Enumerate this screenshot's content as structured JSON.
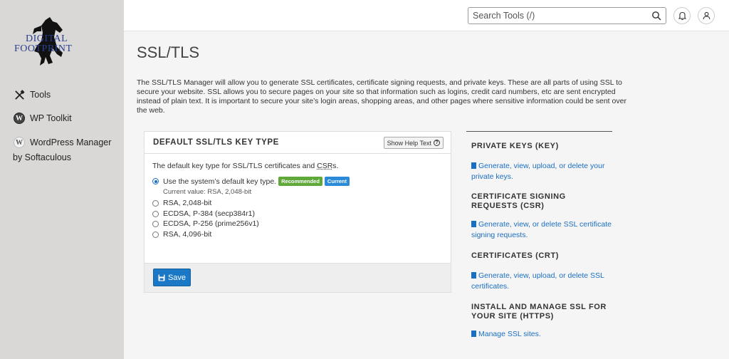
{
  "sidebar": {
    "logo": {
      "line1": "DIGITAL",
      "line2": "FOOTPRINT"
    },
    "items": [
      {
        "label": "Tools",
        "icon": "tools-icon"
      },
      {
        "label": "WP Toolkit",
        "icon": "wordpress-icon"
      },
      {
        "label": "WordPress Manager",
        "icon": "wordpress-icon"
      }
    ],
    "item3_sub": "by Softaculous"
  },
  "header": {
    "search_placeholder": "Search Tools (/)",
    "icons": [
      "search-icon",
      "bell-icon",
      "user-icon"
    ]
  },
  "main": {
    "title": "SSL/TLS",
    "intro": "The SSL/TLS Manager will allow you to generate SSL certificates, certificate signing requests, and private keys. These are all parts of using SSL to secure your website. SSL allows you to secure pages on your site so that information such as logins, credit card numbers, etc are sent encrypted instead of plain text. It is important to secure your site’s login areas, shopping areas, and other pages where sensitive information could be sent over the web.",
    "panel": {
      "title": "DEFAULT SSL/TLS KEY TYPE",
      "help_label": "Show Help Text",
      "desc_prefix": "The default key type for SSL/TLS certificates and ",
      "desc_abbr": "CSR",
      "desc_suffix": "s.",
      "options": [
        {
          "label": "Use the system’s default key type.",
          "checked": true
        },
        {
          "label": "RSA, 2,048-bit",
          "checked": false
        },
        {
          "label": "ECDSA, P-384 (secp384r1)",
          "checked": false
        },
        {
          "label": "ECDSA, P-256 (prime256v1)",
          "checked": false
        },
        {
          "label": "RSA, 4,096-bit",
          "checked": false
        }
      ],
      "badges": {
        "recommended": "Recommended",
        "current": "Current"
      },
      "current_value": "Current value: RSA, 2,048-bit",
      "save_label": "Save"
    }
  },
  "right": {
    "sections": [
      {
        "heading": "PRIVATE KEYS (KEY)",
        "link": "Generate, view, upload, or delete your private keys."
      },
      {
        "heading": "CERTIFICATE SIGNING REQUESTS (CSR)",
        "link": "Generate, view, or delete SSL certificate signing requests."
      },
      {
        "heading": "CERTIFICATES (CRT)",
        "link": "Generate, view, upload, or delete SSL certificates."
      },
      {
        "heading": "INSTALL AND MANAGE SSL FOR YOUR SITE (HTTPS)",
        "link": "Manage SSL sites."
      }
    ]
  },
  "colors": {
    "accent": "#1b78c6",
    "recommended": "#5fa93a",
    "current": "#2c8bd8",
    "sidebar": "#d9d8d6"
  }
}
